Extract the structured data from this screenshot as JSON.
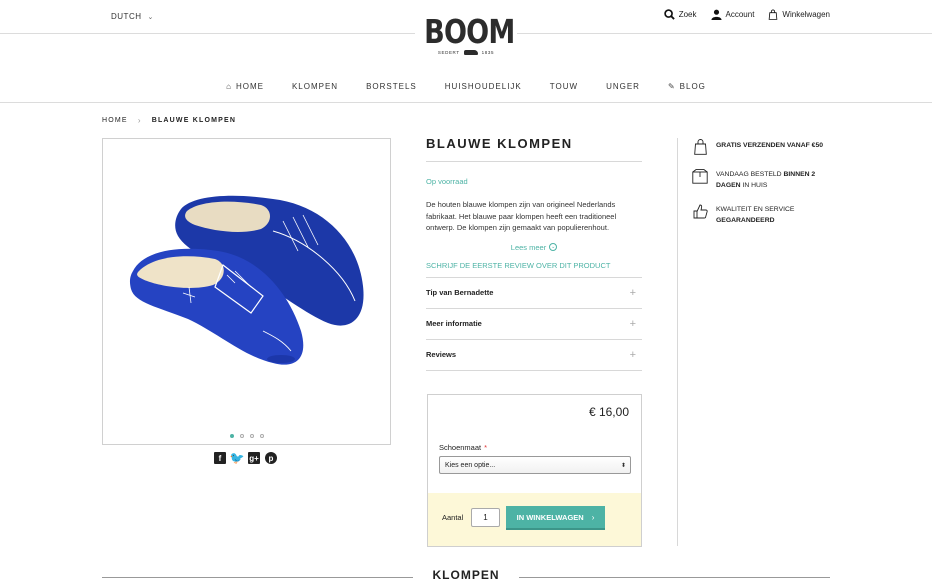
{
  "header": {
    "language": "DUTCH",
    "search_label": "Zoek",
    "account_label": "Account",
    "cart_label": "Winkelwagen"
  },
  "logo": {
    "word": "BOOM",
    "left_sub": "SEDERT",
    "right_sub": "1835"
  },
  "nav": {
    "items": [
      {
        "label": "HOME",
        "icon": "home-icon"
      },
      {
        "label": "KLOMPEN"
      },
      {
        "label": "BORSTELS"
      },
      {
        "label": "HUISHOUDELIJK"
      },
      {
        "label": "TOUW"
      },
      {
        "label": "UNGER"
      },
      {
        "label": "BLOG",
        "icon": "pencil-icon"
      }
    ]
  },
  "breadcrumb": {
    "home": "HOME",
    "current": "BLAUWE KLOMPEN"
  },
  "gallery": {
    "slide_count": 4,
    "active_index": 0
  },
  "share": {
    "icons": [
      "facebook-icon",
      "twitter-icon",
      "google-plus-icon",
      "pinterest-icon"
    ]
  },
  "product": {
    "title": "BLAUWE KLOMPEN",
    "stock": "Op voorraad",
    "description": "De houten blauwe klompen zijn van origineel Nederlands fabrikaat. Het blauwe paar klompen heeft een traditioneel ontwerp. De klompen zijn gemaakt van populierenhout.",
    "read_more": "Lees meer",
    "review_link": "SCHRIJF DE EERSTE REVIEW OVER DIT PRODUCT",
    "accordions": [
      "Tip van Bernadette",
      "Meer informatie",
      "Reviews"
    ]
  },
  "purchase": {
    "price": "€ 16,00",
    "size_label": "Schoenmaat",
    "required_mark": "*",
    "select_value": "Kies een optie...",
    "qty_label": "Aantal",
    "qty_value": "1",
    "cart_button": "IN WINKELWAGEN"
  },
  "usps": [
    {
      "line1": "GRATIS VERZENDEN VANAF €50",
      "line2": "",
      "icon": "shopping-bag-icon"
    },
    {
      "line1": "VANDAAG BESTELD ",
      "bold": "BINNEN 2 DAGEN",
      "line2": " IN HUIS",
      "icon": "box-icon"
    },
    {
      "line1": "KWALITEIT EN SERVICE",
      "line2": "GEGARANDEERD",
      "icon": "thumbs-up-icon"
    }
  ],
  "section_title": "KLOMPEN",
  "colors": {
    "accent": "#4db3a5",
    "clog_blue": "#1f3fb0",
    "buy_footer": "#fdf8d8"
  }
}
